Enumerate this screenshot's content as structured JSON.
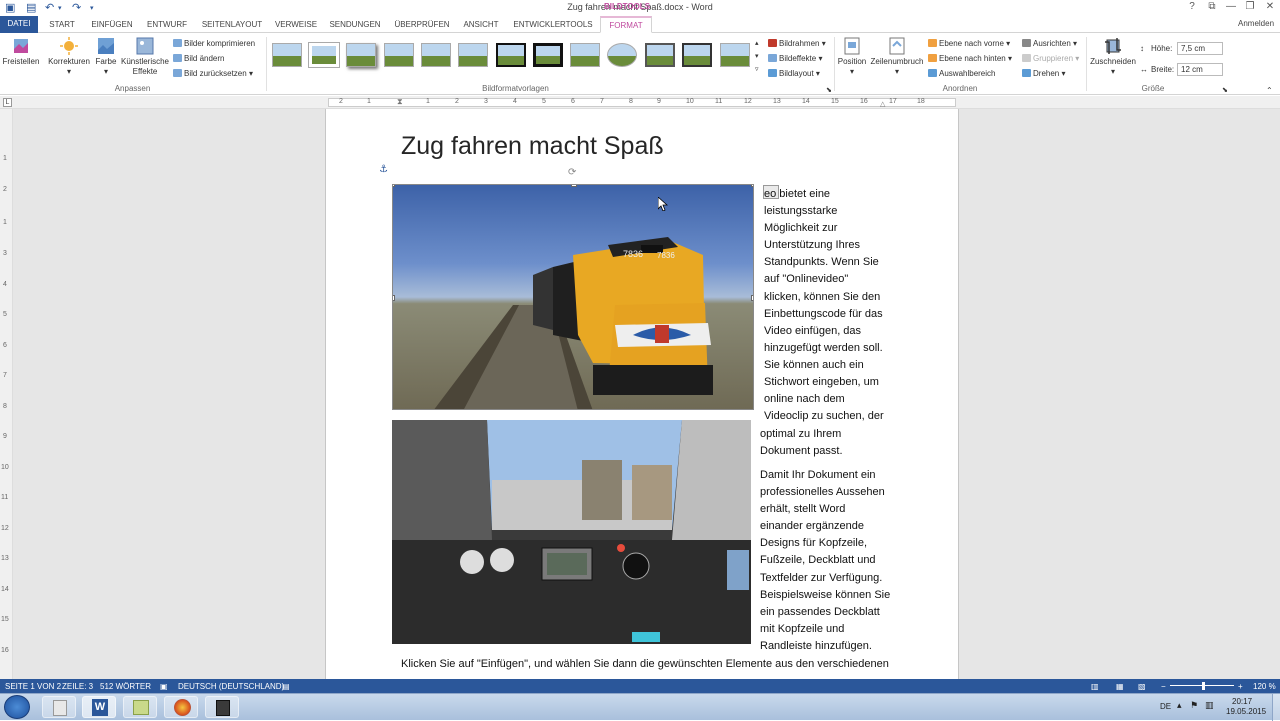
{
  "titlebar": {
    "doc_title": "Zug fahren macht Spaß.docx - Word",
    "context_tab_group": "BILDTOOLS",
    "window_buttons": [
      "?",
      "⧉",
      "—",
      "❐",
      "✕"
    ]
  },
  "tabs": [
    "DATEI",
    "START",
    "EINFÜGEN",
    "ENTWURF",
    "SEITENLAYOUT",
    "VERWEISE",
    "SENDUNGEN",
    "ÜBERPRÜFEN",
    "ANSICHT",
    "ENTWICKLERTOOLS",
    "FORMAT"
  ],
  "anmelden": "Anmelden",
  "ribbon": {
    "freistellen": "Freistellen",
    "korrekturen": "Korrekturen",
    "farbe": "Farbe",
    "kuenstlerisch_1": "Künstlerische",
    "kuenstlerisch_2": "Effekte",
    "bilder_komprimieren": "Bilder komprimieren",
    "bild_aendern": "Bild ändern",
    "bild_zuruecksetzen": "Bild zurücksetzen",
    "group_anpassen": "Anpassen",
    "group_bildformatvorlagen": "Bildformatvorlagen",
    "bildrahmen": "Bildrahmen",
    "bildeffekte": "Bildeffekte",
    "bildlayout": "Bildlayout",
    "position": "Position",
    "zeilenumbruch": "Zeilenumbruch",
    "ebene_vorne": "Ebene nach vorne",
    "ebene_hinten": "Ebene nach hinten",
    "auswahlbereich": "Auswahlbereich",
    "ausrichten": "Ausrichten",
    "gruppieren": "Gruppieren",
    "drehen": "Drehen",
    "group_anordnen": "Anordnen",
    "zuschneiden": "Zuschneiden",
    "hoehe_label": "Höhe:",
    "hoehe_value": "7,5 cm",
    "breite_label": "Breite:",
    "breite_value": "12 cm",
    "group_groesse": "Größe"
  },
  "ruler": {
    "h": [
      "2",
      "1",
      "1",
      "2",
      "3",
      "4",
      "5",
      "6",
      "7",
      "8",
      "9",
      "10",
      "11",
      "12",
      "13",
      "14",
      "15",
      "16",
      "17",
      "18"
    ],
    "v": [
      "1",
      "1",
      "2",
      "3",
      "4",
      "5",
      "6",
      "7",
      "8",
      "9",
      "10",
      "11",
      "12",
      "13",
      "14",
      "15",
      "16",
      "17",
      "18"
    ]
  },
  "document": {
    "heading": "Zug fahren macht Spaß",
    "para1": [
      "eo bietet eine",
      "leistungsstarke",
      "Möglichkeit zur",
      "Unterstützung Ihres",
      "Standpunkts. Wenn Sie",
      "auf \"Onlinevideo\"",
      "klicken, können Sie den",
      "Einbettungscode für das",
      "Video einfügen, das",
      "hinzugefügt werden soll.",
      "Sie können auch ein",
      "Stichwort eingeben, um",
      "online nach dem",
      "Videoclip zu suchen, der",
      "optimal zu Ihrem",
      "Dokument passt."
    ],
    "para2": [
      "Damit Ihr Dokument ein",
      "professionelles Aussehen",
      "erhält, stellt Word",
      "einander ergänzende",
      "Designs für Kopfzeile,",
      "Fußzeile, Deckblatt und",
      "Textfelder zur Verfügung.",
      "Beispielsweise können Sie",
      "ein passendes Deckblatt",
      "mit Kopfzeile und",
      "Randleiste hinzufügen."
    ],
    "para3": "Klicken Sie auf \"Einfügen\", und wählen Sie dann die gewünschten Elemente aus den verschiedenen",
    "img1_number": "7836",
    "img2_sign": "EXIT"
  },
  "status": {
    "page": "SEITE 1 VON 2",
    "line": "ZEILE: 3",
    "words": "512 WÖRTER",
    "language": "DEUTSCH (DEUTSCHLAND)",
    "zoom": "120 %"
  },
  "taskbar": {
    "lang": "DE",
    "time": "20:17",
    "date": "19.05.2015"
  }
}
